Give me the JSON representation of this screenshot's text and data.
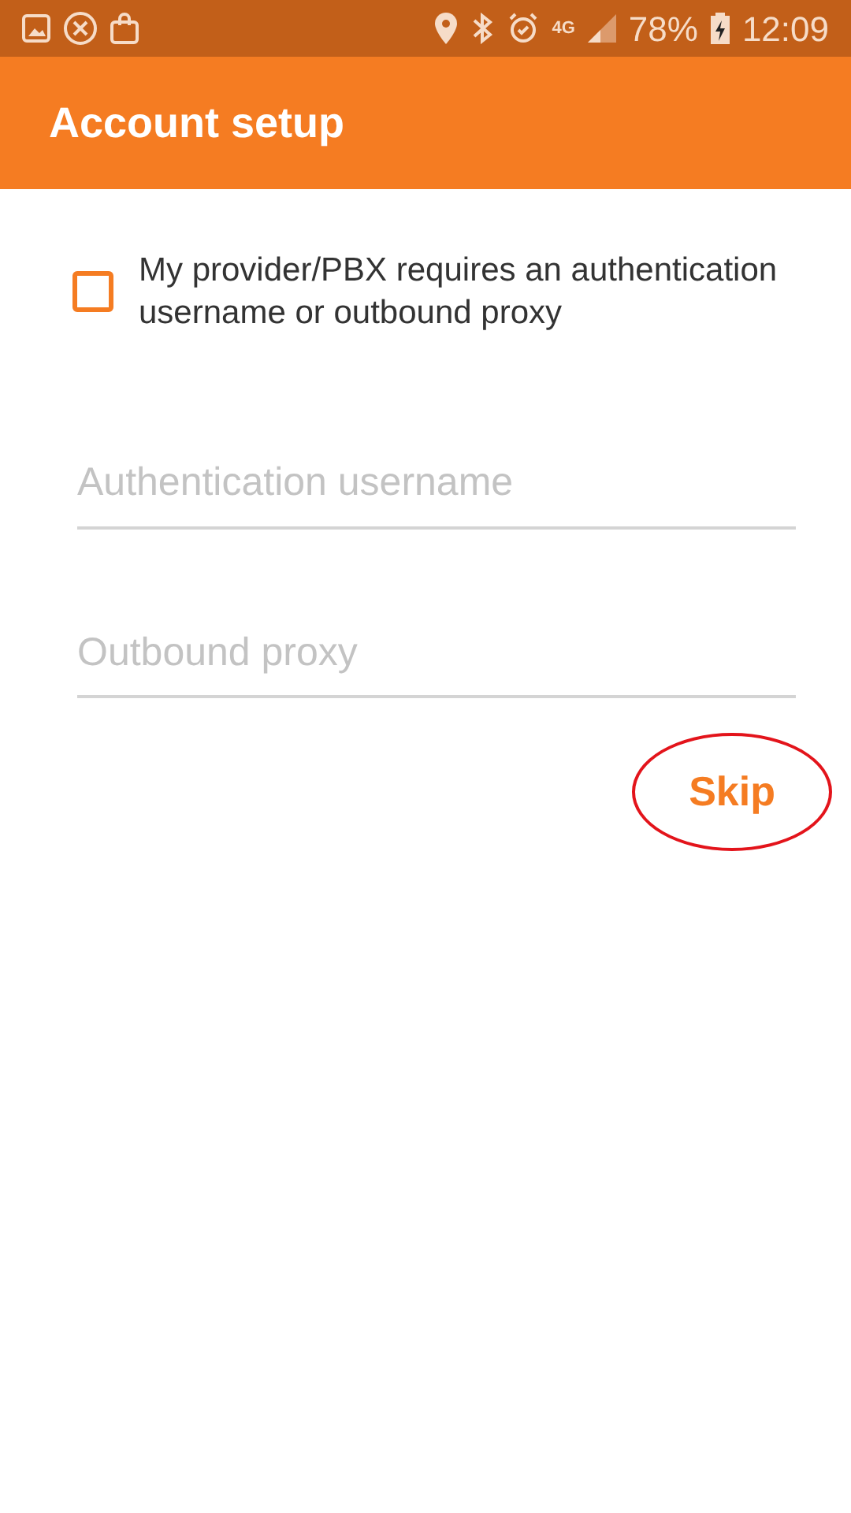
{
  "status_bar": {
    "network": "4G",
    "battery": "78%",
    "time": "12:09"
  },
  "app_bar": {
    "title": "Account setup"
  },
  "checkbox": {
    "label": "My provider/PBX requires an authentication username or outbound proxy",
    "checked": false
  },
  "fields": [
    {
      "placeholder": "Authentication username"
    },
    {
      "placeholder": "Outbound proxy"
    }
  ],
  "skip_button": {
    "label": "Skip",
    "highlighted": true
  }
}
